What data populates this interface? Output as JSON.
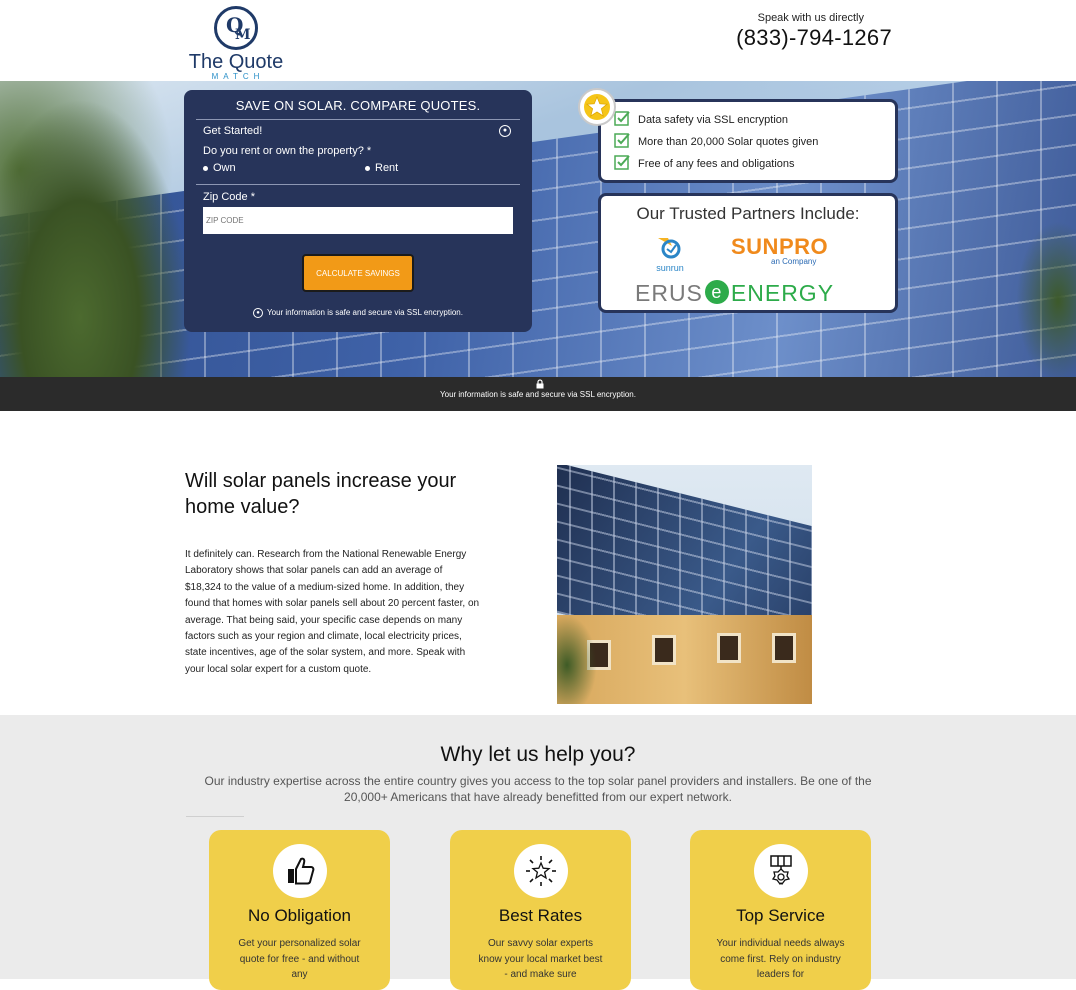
{
  "header": {
    "logo_text": "The Quote",
    "logo_sub": "MATCH",
    "phone_caption": "Speak with us directly",
    "phone_number": "(833)-794-1267"
  },
  "form": {
    "title": "SAVE ON SOLAR. COMPARE QUOTES.",
    "get_started": "Get Started!",
    "question": "Do you rent or own the property? *",
    "option_own": "Own",
    "option_rent": "Rent",
    "zip_label": "Zip Code *",
    "zip_placeholder": "ZIP CODE",
    "cta_label": "CALCULATE SAVINGS",
    "secure_note": "Your information is safe and secure via SSL encryption."
  },
  "trust": {
    "items": [
      "Data safety via SSL encryption",
      "More than 20,000 Solar quotes given",
      "Free of any fees and obligations"
    ]
  },
  "partners": {
    "title": "Our Trusted Partners Include:",
    "sunrun": "sunrun",
    "sunpro": "SUNPRO",
    "sunpro_sub": "an Company",
    "erus": "ERUS",
    "energy": "ENERGY"
  },
  "strip": {
    "text": "Your information is safe and secure via SSL encryption."
  },
  "article": {
    "title": "Will solar panels increase your home value?",
    "body": "It definitely can. Research from the National Renewable Energy Laboratory shows that solar panels can add an average of $18,324 to the value of a medium-sized home. In addition, they found that homes with solar panels sell about 20 percent faster, on average. That being said, your specific case depends on many factors such as your region and climate, local electricity prices, state incentives, age of the solar system, and more. Speak with your local solar expert for a custom quote."
  },
  "why": {
    "title": "Why let us help you?",
    "subtitle": "Our industry expertise across the entire country gives you access to the top solar panel providers and installers. Be one of the 20,000+ Americans that have already benefitted from our expert network.",
    "features": [
      {
        "title": "No Obligation",
        "text": "Get your personalized solar quote for free - and without any",
        "icon": "thumbs-up-icon"
      },
      {
        "title": "Best Rates",
        "text": "Our savvy solar experts know your local market best - and make sure",
        "icon": "star-badge-icon"
      },
      {
        "title": "Top Service",
        "text": "Your individual needs always come first. Rely on industry leaders for",
        "icon": "medal-icon"
      }
    ]
  },
  "colors": {
    "navy": "#27345a",
    "cta_orange": "#f29a17",
    "feature_yellow": "#f0cf4a",
    "strip_dark": "#2b2b2b"
  }
}
